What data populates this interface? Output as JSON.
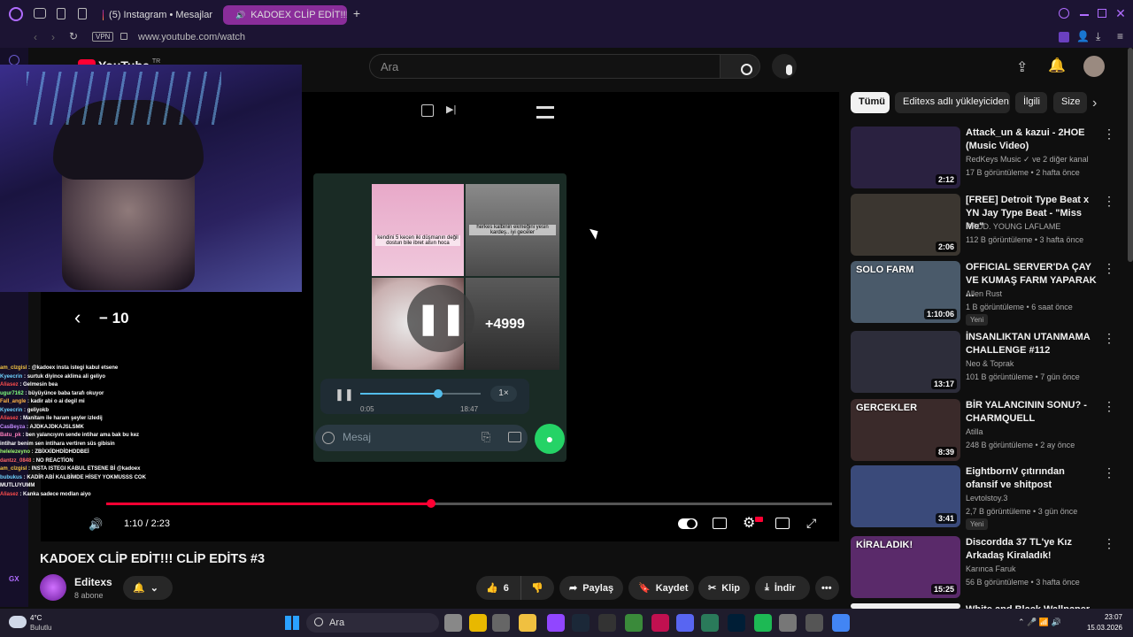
{
  "browser": {
    "tabs": [
      {
        "label": "(5) Instagram • Mesajlar"
      },
      {
        "label": "KADOEX CLİP EDİT!!! C"
      }
    ],
    "vpn": "VPN",
    "url": "www.youtube.com/watch"
  },
  "youtube": {
    "logo": "YouTube",
    "region": "TR",
    "search_placeholder": "Ara"
  },
  "player": {
    "seek_label": "− 10",
    "time": "1:10 / 2:23",
    "progress_fraction": 0.4476,
    "phone": {
      "meme1_caption": "kendini 5 kecen iki düşmanın değil dostun bile ibret alsın hoca",
      "meme2_caption": "herkes kalbinin ekmeğini yesin kardeş.. iyi geceler",
      "count_badge": "+4999",
      "audio_start": "0:05",
      "audio_end": "18:47",
      "speed": "1×",
      "message_placeholder": "Mesaj"
    },
    "chat": [
      {
        "user": "am_clzgisl",
        "color": "#f5c542",
        "text": ": @kadoex insta istegi kabul etsene"
      },
      {
        "user": "Kyeecrin",
        "color": "#6fd3ff",
        "text": ": surtuk diyince aklima ali geliyo"
      },
      {
        "user": "Aliasez",
        "color": "#ff4d4d",
        "text": ": Gelmesin bea"
      },
      {
        "user": "ugur7162",
        "color": "#7fff7f",
        "text": ": büyüyünce baba tarafı okuyor"
      },
      {
        "user": "Fall_angle",
        "color": "#ffb347",
        "text": ": kadir abi o ai degil mi"
      },
      {
        "user": "Kyeecrin",
        "color": "#6fd3ff",
        "text": ": geliyokb"
      },
      {
        "user": "Aliasez",
        "color": "#ff4d4d",
        "text": ": Manitam ile haram şeyler izledij"
      },
      {
        "user": "CasBeyza",
        "color": "#c58bff",
        "text": ": AJDKAJDKAJSLSMK"
      },
      {
        "user": "Batu_pk",
        "color": "#ff7fbf",
        "text": ": ben yalancıyım sende intihar ama bak bu kez intihar benim sen intihara vertiren süs gibisin"
      },
      {
        "user": "helelezeyno",
        "color": "#9fff6f",
        "text": ": ZBİXXİDHDİDHDDBEİ"
      },
      {
        "user": "dantzz_0848",
        "color": "#ff6666",
        "text": ": NO REACTİON"
      },
      {
        "user": "am_clzgisl",
        "color": "#f5c542",
        "text": ": INSTA ISTEGI KABUL ETSENE Bİ @kadoex"
      },
      {
        "user": "bubukus",
        "color": "#6fd3ff",
        "text": ": KADİR ABİ KALBİMDE HİSEY YOKMUSSS COK MUTLUYUMM"
      },
      {
        "user": "Aliasez",
        "color": "#ff4d4d",
        "text": ": Kanka sadece modlan aiyo"
      }
    ]
  },
  "video": {
    "title": "KADOEX CLİP EDİT!!! CLİP EDİTS #3",
    "channel": "Editexs",
    "subscribers": "8 abone",
    "likes": "6",
    "share": "Paylaş",
    "save": "Kaydet",
    "clip": "Klip",
    "download": "İndir"
  },
  "filters": [
    "Tümü",
    "Editexs adlı yükleyiciden",
    "İlgili",
    "Size"
  ],
  "recommendations": [
    {
      "title": "Attack_un & kazui - 2HOE (Music Video)",
      "channel": "RedKeys Music",
      "extra": "ve 2 diğer kanal",
      "meta": "17 B görüntüleme • 2 hafta önce",
      "duration": "2:12",
      "badge": "",
      "thumb": "#2a2140"
    },
    {
      "title": "[FREE] Detroit Type Beat x YN Jay Type Beat - \"Miss Me\"",
      "channel": "PROD. YOUNG LAFLAME",
      "extra": "",
      "meta": "112 B görüntüleme • 3 hafta önce",
      "duration": "2:06",
      "badge": "",
      "thumb": "#3b3630"
    },
    {
      "title": "OFFICIAL SERVER'DA ÇAY VE KUMAŞ FARM YAPARAK ...",
      "channel": "Allen Rust",
      "extra": "",
      "meta": "1 B görüntüleme • 6 saat önce",
      "duration": "1:10:06",
      "badge": "Yeni",
      "thumb": "#4a5a6a",
      "overlay": "SOLO FARM"
    },
    {
      "title": "İNSANLIKTAN UTANMAMA CHALLENGE #112",
      "channel": "Neo & Toprak",
      "extra": "",
      "meta": "101 B görüntüleme • 7 gün önce",
      "duration": "13:17",
      "badge": "",
      "thumb": "#2d2d3a"
    },
    {
      "title": "BİR YALANCININ SONU? - CHARMQUELL",
      "channel": "Atilla",
      "extra": "",
      "meta": "248 B görüntüleme • 2 ay önce",
      "duration": "8:39",
      "badge": "",
      "thumb": "#3a2a2a",
      "overlay": "GERCEKLER"
    },
    {
      "title": "EightbornV çıtırından ofansif ve shitpost",
      "channel": "Levtolstoy.3",
      "extra": "",
      "meta": "2,7 B görüntüleme • 3 gün önce",
      "duration": "3:41",
      "badge": "Yeni",
      "thumb": "#3a4a7a"
    },
    {
      "title": "Discordda 37 TL'ye Kız Arkadaş Kiraladık!",
      "channel": "Karınca Faruk",
      "extra": "",
      "meta": "56 B görüntüleme • 3 hafta önce",
      "duration": "15:25",
      "badge": "",
      "thumb": "#5a2a6a",
      "overlay": "KİRALADIK!"
    },
    {
      "title": "White and Black Wallpaper",
      "channel": "",
      "extra": "",
      "meta": "",
      "duration": "",
      "badge": "",
      "thumb": "#eeeeee"
    }
  ],
  "taskbar": {
    "weather_temp": "4°C",
    "weather_desc": "Bulutlu",
    "search": "Ara",
    "time": "23:07",
    "date": "15.03.2026"
  },
  "colors": {
    "accent_red": "#ff0033",
    "whatsapp_green": "#25d366",
    "browser_bg": "#1c1433"
  }
}
